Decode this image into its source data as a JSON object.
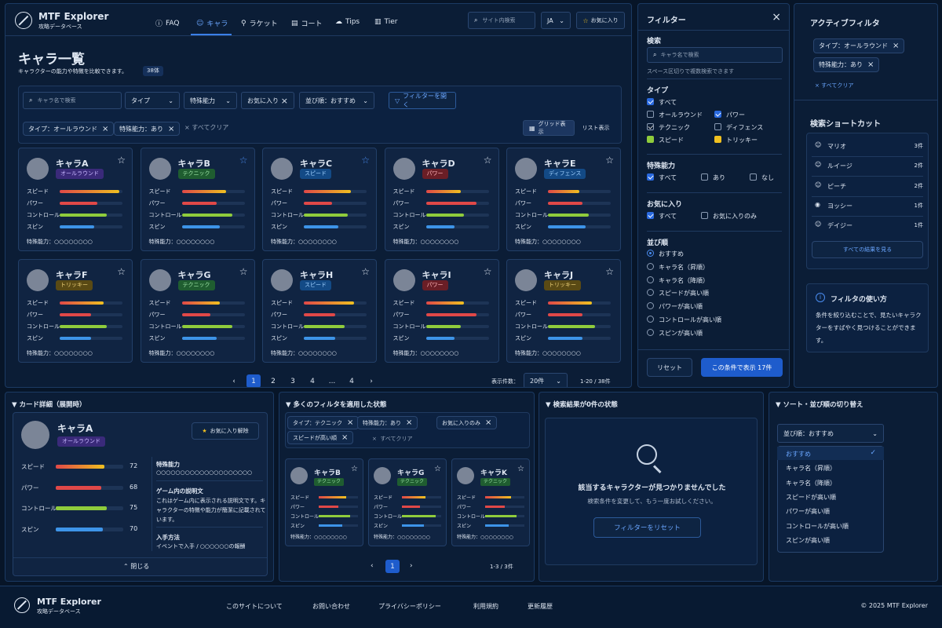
{
  "app": {
    "name": "MTF Explorer",
    "subtitle": "攻略データベース"
  },
  "nav": [
    {
      "label": "FAQ",
      "icon": "question-icon"
    },
    {
      "label": "キャラ",
      "icon": "user-icon"
    },
    {
      "label": "ラケット",
      "icon": "racket-icon"
    },
    {
      "label": "コート",
      "icon": "court-icon"
    },
    {
      "label": "Tips",
      "icon": "chat-icon"
    },
    {
      "label": "Tier",
      "icon": "bar-chart-icon"
    }
  ],
  "header": {
    "search_placeholder": "サイト内検索",
    "lang": "JA",
    "favorites": "お気に入り"
  },
  "page": {
    "title": "キャラ一覧",
    "desc": "キャラクターの能力や特徴を比較できます。",
    "count": "38体"
  },
  "toolbar": {
    "search_placeholder": "キャラ名で検索",
    "type": "タイプ",
    "ability": "特殊能力",
    "fav": "お気に入り",
    "sort": "並び順：おすすめ",
    "open_filter": "フィルターを開く",
    "grid": "グリッド表示",
    "list": "リスト表示",
    "clear": "すべてクリア"
  },
  "active_chips": [
    "タイプ：オールラウンド",
    "特殊能力：あり"
  ],
  "stat_labels": [
    "スピード",
    "パワー",
    "コントロール",
    "スピン"
  ],
  "special_label": "特殊能力：○○○○○○○○",
  "cards": [
    {
      "name": "キャラA",
      "type": "オールラウンド",
      "tc": "#3a2a7a",
      "tt": "#c7b6ff",
      "fav": false,
      "stats": [
        0.95,
        0.6,
        0.75,
        0.55
      ]
    },
    {
      "name": "キャラB",
      "type": "テクニック",
      "tc": "#1f5d30",
      "tt": "#9be2a4",
      "fav": true,
      "stats": [
        0.7,
        0.55,
        0.8,
        0.6
      ]
    },
    {
      "name": "キャラC",
      "type": "スピード",
      "tc": "#134a86",
      "tt": "#9fd0ff",
      "fav": true,
      "stats": [
        0.75,
        0.45,
        0.7,
        0.55
      ]
    },
    {
      "name": "キャラD",
      "type": "パワー",
      "tc": "#6a1e26",
      "tt": "#ffb3b8",
      "fav": false,
      "stats": [
        0.55,
        0.8,
        0.6,
        0.45
      ]
    },
    {
      "name": "キャラE",
      "type": "ディフェンス",
      "tc": "#134a86",
      "tt": "#9fd0ff",
      "fav": false,
      "stats": [
        0.5,
        0.55,
        0.65,
        0.6
      ]
    },
    {
      "name": "キャラF",
      "type": "トリッキー",
      "tc": "#5a4a14",
      "tt": "#f0d37a",
      "fav": false,
      "stats": [
        0.7,
        0.5,
        0.75,
        0.5
      ]
    },
    {
      "name": "キャラG",
      "type": "テクニック",
      "tc": "#1f5d30",
      "tt": "#9be2a4",
      "fav": false,
      "stats": [
        0.6,
        0.45,
        0.8,
        0.55
      ]
    },
    {
      "name": "キャラH",
      "type": "スピード",
      "tc": "#134a86",
      "tt": "#9fd0ff",
      "fav": false,
      "stats": [
        0.8,
        0.5,
        0.65,
        0.5
      ]
    },
    {
      "name": "キャラI",
      "type": "パワー",
      "tc": "#6a1e26",
      "tt": "#ffb3b8",
      "fav": false,
      "stats": [
        0.6,
        0.8,
        0.55,
        0.45
      ]
    },
    {
      "name": "キャラJ",
      "type": "トリッキー",
      "tc": "#5a4a14",
      "tt": "#f0d37a",
      "fav": false,
      "stats": [
        0.7,
        0.55,
        0.75,
        0.55
      ]
    }
  ],
  "pagination": {
    "pages": [
      "1",
      "2",
      "3",
      "4",
      "...",
      "4"
    ],
    "per_page_label": "表示件数：",
    "per_page": "20件",
    "range": "1-20 / 38件"
  },
  "filter": {
    "title": "フィルター",
    "search_label": "検索",
    "search_placeholder": "キャラ名で検索",
    "search_hint": "スペース区切りで複数検索できます",
    "type_label": "タイプ",
    "types": [
      [
        "すべて",
        "on"
      ],
      [
        "オールラウンド",
        ""
      ],
      [
        "パワー",
        "on"
      ],
      [
        "テクニック",
        "gr"
      ],
      [
        "ディフェンス",
        ""
      ],
      [
        "スピード",
        "gy"
      ],
      [
        "トリッキー",
        "yl"
      ]
    ],
    "ability_label": "特殊能力",
    "abilities": [
      [
        "すべて",
        "on"
      ],
      [
        "あり",
        ""
      ],
      [
        "なし",
        ""
      ]
    ],
    "fav_label": "お気に入り",
    "favs": [
      [
        "すべて",
        "on"
      ],
      [
        "お気に入りのみ",
        ""
      ]
    ],
    "sort_label": "並び順",
    "sorts": [
      "おすすめ",
      "キャラ名（昇順）",
      "キャラ名（降順）",
      "スピードが高い順",
      "パワーが高い順",
      "コントロールが高い順",
      "スピンが高い順"
    ],
    "reset": "リセット",
    "apply": "この条件で表示",
    "apply_count": "17件"
  },
  "active_filter": {
    "title": "アクティブフィルタ",
    "chips": [
      "タイプ：オールラウンド",
      "特殊能力：あり"
    ],
    "clear": "すべてクリア"
  },
  "shortcuts": {
    "title": "検索ショートカット",
    "items": [
      [
        "マリオ",
        "3件",
        "user-icon"
      ],
      [
        "ルイージ",
        "2件",
        "user-icon"
      ],
      [
        "ピーチ",
        "2件",
        "user-icon"
      ],
      [
        "ヨッシー",
        "1件",
        "egg-icon"
      ],
      [
        "デイジー",
        "1件",
        "user-icon"
      ]
    ],
    "see_all": "すべての結果を見る"
  },
  "howto": {
    "title": "フィルタの使い方",
    "body": "条件を絞り込むことで、見たいキャラクターをすばやく見つけることができます。"
  },
  "detail": {
    "title": "▼ カード詳細（展開時）",
    "name": "キャラA",
    "type": "オールラウンド",
    "fav_remove": "お気に入り解除",
    "stats": [
      72,
      68,
      75,
      70
    ],
    "ability_title": "特殊能力",
    "ability_value": "○○○○○○○○○○○○○○○○○○○○",
    "desc_title": "ゲーム内の説明文",
    "desc": "これはゲーム内に表示される説明文です。キャラクターの特徴や能力が簡潔に記載されています。",
    "obtain_title": "入手方法",
    "obtain": "イベントで入手 / ○○○○○○の報酬",
    "close": "閉じる"
  },
  "many": {
    "title": "▼ 多くのフィルタを適用した状態",
    "chips": [
      "タイプ：テクニック",
      "特殊能力：あり",
      "お気に入りのみ",
      "スピードが高い順"
    ],
    "clear": "すべてクリア",
    "cards": [
      {
        "name": "キャラB",
        "type": "テクニック"
      },
      {
        "name": "キャラG",
        "type": "テクニック"
      },
      {
        "name": "キャラK",
        "type": "テクニック"
      }
    ],
    "page": "1",
    "range": "1-3 / 3件"
  },
  "empty": {
    "title": "▼ 検索結果が0件の状態",
    "msg": "該当するキャラクターが見つかりませんでした",
    "hint": "検索条件を変更して、もう一度お試しください。",
    "reset": "フィルターをリセット"
  },
  "sortdemo": {
    "title": "▼ ソート・並び順の切り替え",
    "selected": "並び順：おすすめ",
    "options": [
      "おすすめ",
      "キャラ名（昇順）",
      "キャラ名（降順）",
      "スピードが高い順",
      "パワーが高い順",
      "コントロールが高い順",
      "スピンが高い順"
    ]
  },
  "footer": {
    "name": "MTF Explorer",
    "subtitle": "攻略データベース",
    "links": [
      "このサイトについて",
      "お問い合わせ",
      "プライバシーポリシー",
      "利用規約",
      "更新履歴"
    ],
    "copy": "© 2025 MTF Explorer"
  }
}
